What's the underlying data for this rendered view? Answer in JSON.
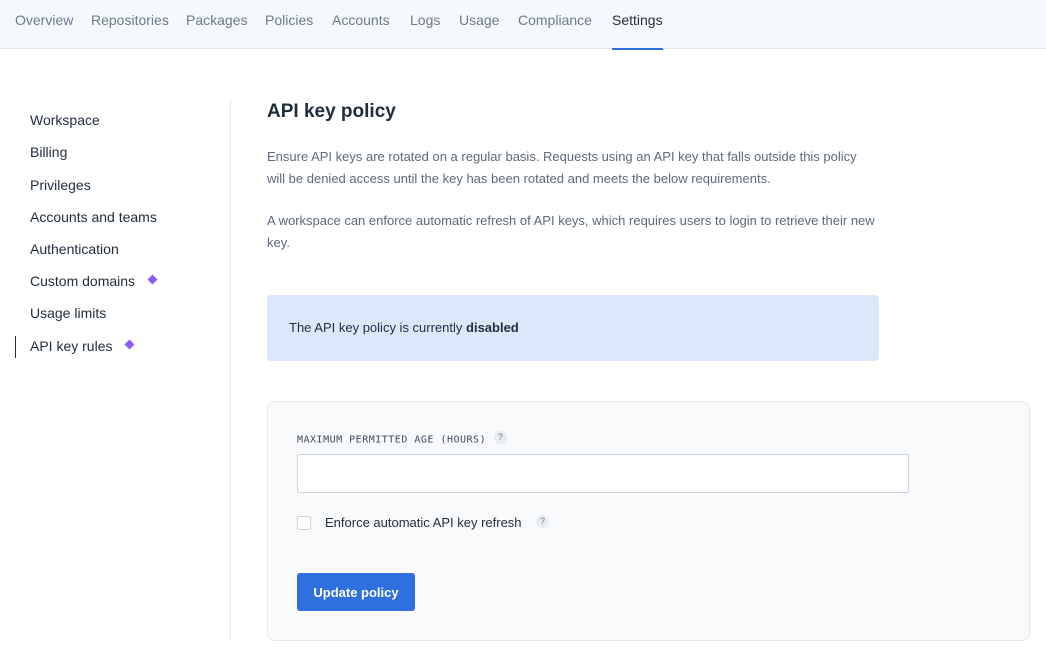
{
  "topnav": {
    "tabs": [
      {
        "label": "Overview"
      },
      {
        "label": "Repositories"
      },
      {
        "label": "Packages"
      },
      {
        "label": "Policies"
      },
      {
        "label": "Accounts"
      },
      {
        "label": "Logs"
      },
      {
        "label": "Usage"
      },
      {
        "label": "Compliance"
      },
      {
        "label": "Settings",
        "active": true
      }
    ],
    "active_color": "#2f6fde"
  },
  "sidebar": {
    "items": [
      {
        "label": "Workspace"
      },
      {
        "label": "Billing"
      },
      {
        "label": "Privileges"
      },
      {
        "label": "Accounts and teams"
      },
      {
        "label": "Authentication"
      },
      {
        "label": "Custom domains",
        "badge_icon": "diamond-icon"
      },
      {
        "label": "Usage limits"
      },
      {
        "label": "API key rules",
        "badge_icon": "diamond-icon",
        "active": true
      }
    ],
    "badge_color": "#8b5cf6"
  },
  "main": {
    "title": "API key policy",
    "paragraph1": "Ensure API keys are rotated on a regular basis. Requests using an API key that falls outside this policy will be denied access until the key has been rotated and meets the below requirements.",
    "paragraph2": "A workspace can enforce automatic refresh of API keys, which requires users to login to retrieve their new key.",
    "notice": {
      "prefix": "The API key policy is currently ",
      "status": "disabled",
      "background": "#dbe8fb"
    },
    "form": {
      "max_age_label": "MAXIMUM PERMITTED AGE (HOURS)",
      "max_age_value": "",
      "help_glyph": "?",
      "enforce_label": "Enforce automatic API key refresh",
      "enforce_checked": false,
      "submit_label": "Update policy",
      "submit_color": "#2f6fde"
    }
  }
}
